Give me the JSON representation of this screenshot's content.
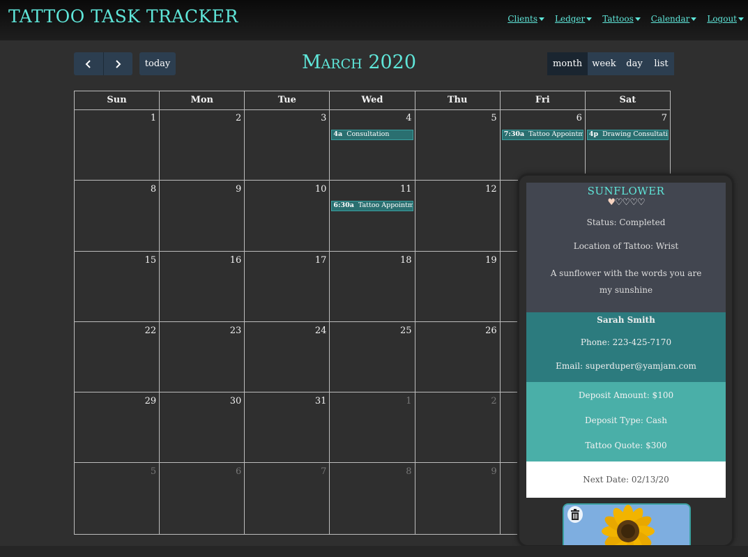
{
  "app": {
    "brand": "TATTOO TASK TRACKER"
  },
  "nav": [
    {
      "label": "Clients"
    },
    {
      "label": "Ledger"
    },
    {
      "label": "Tattoos"
    },
    {
      "label": "Calendar"
    },
    {
      "label": "Logout"
    }
  ],
  "toolbar": {
    "today_label": "today",
    "title": "March 2020",
    "views": [
      "month",
      "week",
      "day",
      "list"
    ],
    "active_view": "month"
  },
  "calendar": {
    "weekdays": [
      "Sun",
      "Mon",
      "Tue",
      "Wed",
      "Thu",
      "Fri",
      "Sat"
    ],
    "weeks": [
      [
        {
          "n": "1"
        },
        {
          "n": "2"
        },
        {
          "n": "3"
        },
        {
          "n": "4"
        },
        {
          "n": "5"
        },
        {
          "n": "6"
        },
        {
          "n": "7"
        }
      ],
      [
        {
          "n": "8"
        },
        {
          "n": "9"
        },
        {
          "n": "10"
        },
        {
          "n": "11"
        },
        {
          "n": "12"
        },
        {
          "n": ""
        },
        {
          "n": ""
        }
      ],
      [
        {
          "n": "15"
        },
        {
          "n": "16"
        },
        {
          "n": "17"
        },
        {
          "n": "18"
        },
        {
          "n": "19"
        },
        {
          "n": ""
        },
        {
          "n": ""
        }
      ],
      [
        {
          "n": "22"
        },
        {
          "n": "23"
        },
        {
          "n": "24"
        },
        {
          "n": "25"
        },
        {
          "n": "26"
        },
        {
          "n": ""
        },
        {
          "n": ""
        }
      ],
      [
        {
          "n": "29"
        },
        {
          "n": "30"
        },
        {
          "n": "31"
        },
        {
          "n": "1",
          "other": true
        },
        {
          "n": "2",
          "other": true
        },
        {
          "n": ""
        },
        {
          "n": ""
        }
      ],
      [
        {
          "n": "5",
          "other": true
        },
        {
          "n": "6",
          "other": true
        },
        {
          "n": "7",
          "other": true
        },
        {
          "n": "8",
          "other": true
        },
        {
          "n": "9",
          "other": true
        },
        {
          "n": ""
        },
        {
          "n": ""
        }
      ]
    ],
    "events": [
      {
        "week": 0,
        "day": 3,
        "time": "4a",
        "title": "Consultation"
      },
      {
        "week": 0,
        "day": 5,
        "time": "7:30a",
        "title": "Tattoo Appointment"
      },
      {
        "week": 0,
        "day": 6,
        "time": "4p",
        "title": "Drawing Consultation"
      },
      {
        "week": 1,
        "day": 3,
        "time": "6:30a",
        "title": "Tattoo Appointment"
      }
    ]
  },
  "popup": {
    "title": "SUNFLOWER",
    "rating": 1,
    "rating_max": 5,
    "status": "Status: Completed",
    "location": "Location of Tattoo: Wrist",
    "description": "A sunflower with the words you are my sunshine",
    "client_name": "Sarah Smith",
    "phone": "Phone: 223-425-7170",
    "email": "Email: superduper@yamjam.com",
    "deposit_amount": "Deposit Amount: $100",
    "deposit_type": "Deposit Type: Cash",
    "quote": "Tattoo Quote: $300",
    "next_date": "Next Date: 02/13/20"
  },
  "colors": {
    "accent": "#5fe6d9",
    "button": "#2c3e50",
    "event": "#2a6f70"
  }
}
